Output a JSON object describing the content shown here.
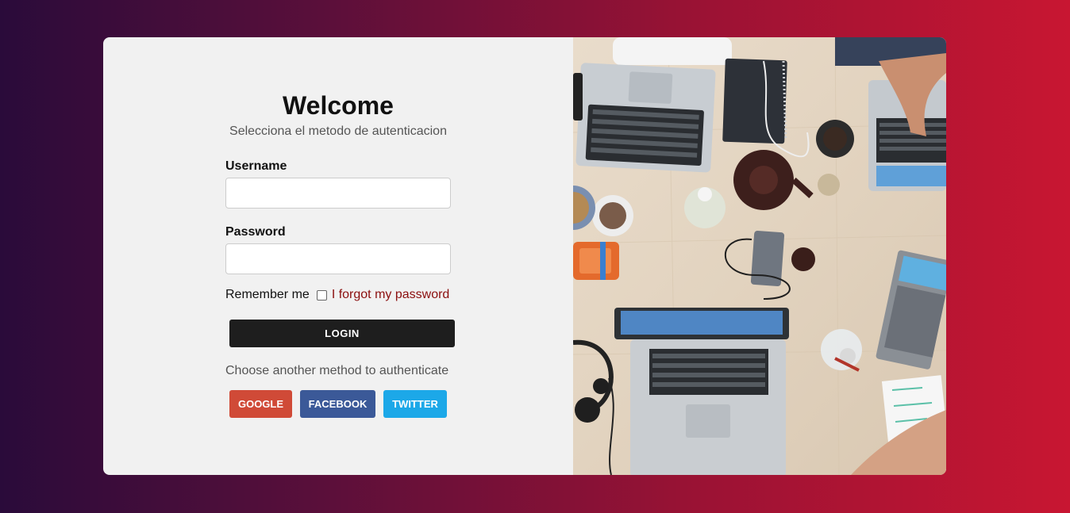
{
  "login": {
    "title": "Welcome",
    "subtitle": "Selecciona el metodo de autenticacion",
    "username_label": "Username",
    "username_value": "",
    "password_label": "Password",
    "password_value": "",
    "remember_label": "Remember me",
    "remember_checked": false,
    "forgot_link": "I forgot my password",
    "login_button": "LOGIN",
    "alt_method_text": "Choose another method to authenticate"
  },
  "social": {
    "google_label": "GOOGLE",
    "facebook_label": "FACEBOOK",
    "twitter_label": "TWITTER"
  },
  "colors": {
    "background_start": "#2a0b3a",
    "background_end": "#c81632",
    "login_button": "#1e1e1e",
    "google": "#d04a37",
    "facebook": "#3b5998",
    "twitter": "#1ca8e8",
    "forgot_link": "#8b0f0f"
  },
  "image": {
    "subject": "workspace-photo"
  }
}
